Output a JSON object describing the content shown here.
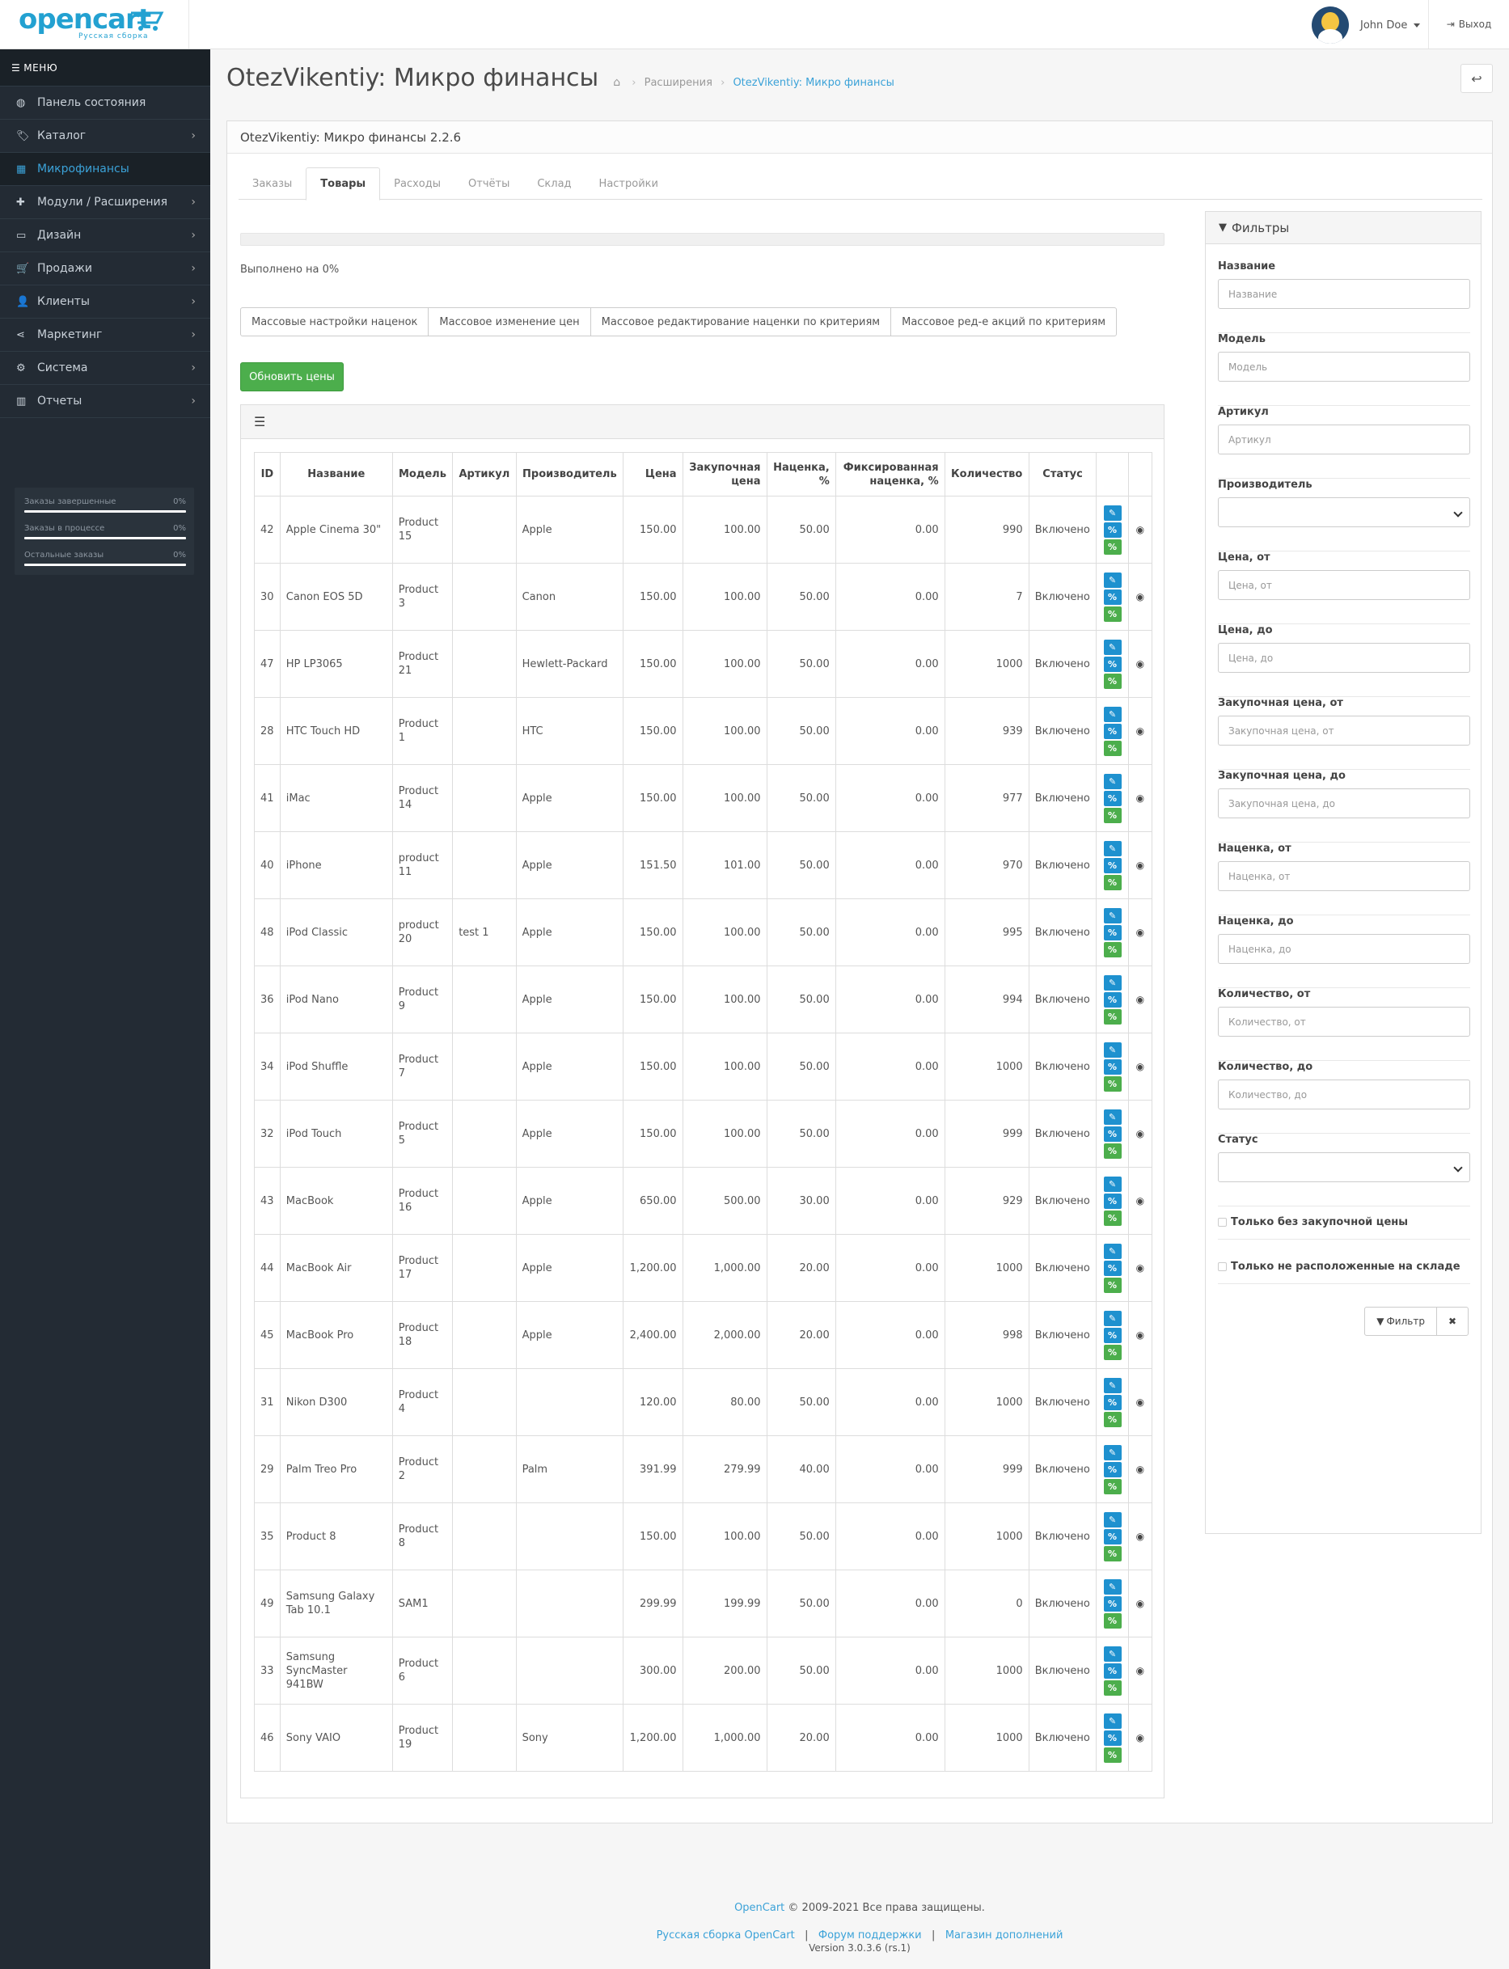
{
  "header": {
    "logo_word": "opencart",
    "logo_sub": "Русская сборка",
    "user_name": "John Doe",
    "logout": "Выход"
  },
  "sidebar": {
    "menu_label": "МЕНЮ",
    "items": [
      {
        "label": "Панель состояния",
        "icon": "dashboard-icon",
        "glyph": "◍",
        "arrow": false
      },
      {
        "label": "Каталог",
        "icon": "tags-icon",
        "glyph": "🏷",
        "arrow": true
      },
      {
        "label": "Микрофинансы",
        "icon": "table-icon",
        "glyph": "▦",
        "arrow": false,
        "active": true
      },
      {
        "label": "Модули / Расширения",
        "icon": "puzzle-icon",
        "glyph": "✚",
        "arrow": true
      },
      {
        "label": "Дизайн",
        "icon": "desktop-icon",
        "glyph": "▭",
        "arrow": true
      },
      {
        "label": "Продажи",
        "icon": "cart-icon",
        "glyph": "🛒",
        "arrow": true
      },
      {
        "label": "Клиенты",
        "icon": "user-icon",
        "glyph": "👤",
        "arrow": true
      },
      {
        "label": "Маркетинг",
        "icon": "share-icon",
        "glyph": "⋖",
        "arrow": true
      },
      {
        "label": "Система",
        "icon": "cog-icon",
        "glyph": "⚙",
        "arrow": true
      },
      {
        "label": "Отчеты",
        "icon": "bar-chart-icon",
        "glyph": "▥",
        "arrow": true
      }
    ],
    "stats": [
      {
        "label": "Заказы завершенные",
        "value": "0%",
        "progress": 0
      },
      {
        "label": "Заказы в процессе",
        "value": "0%",
        "progress": 0
      },
      {
        "label": "Остальные заказы",
        "value": "0%",
        "progress": 0
      }
    ]
  },
  "page": {
    "title": "OtezVikentiy: Микро финансы",
    "breadcrumb": [
      "Расширения",
      "OtezVikentiy: Микро финансы"
    ],
    "panel_title": "OtezVikentiy: Микро финансы 2.2.6",
    "tabs": [
      "Заказы",
      "Товары",
      "Расходы",
      "Отчёты",
      "Склад",
      "Настройки"
    ],
    "active_tab": "Товары",
    "progress_text": "Выполнено на 0%",
    "progress": 0,
    "mass_buttons": [
      "Массовые настройки наценок",
      "Массовое изменение цен",
      "Массовое редактирование наценки по критериям",
      "Массовое ред-е акций по критериям"
    ],
    "update_button": "Обновить цены"
  },
  "table": {
    "columns": [
      "ID",
      "Название",
      "Модель",
      "Артикул",
      "Производитель",
      "Цена",
      "Закупочная цена",
      "Наценка, %",
      "Фиксированная наценка, %",
      "Количество",
      "Статус"
    ],
    "rows": [
      {
        "id": "42",
        "name": "Apple Cinema 30\"",
        "model": "Product 15",
        "sku": "",
        "maker": "Apple",
        "price": "150.00",
        "cost": "100.00",
        "markup": "50.00",
        "fixed": "0.00",
        "qty": "990",
        "status": "Включено"
      },
      {
        "id": "30",
        "name": "Canon EOS 5D",
        "model": "Product 3",
        "sku": "",
        "maker": "Canon",
        "price": "150.00",
        "cost": "100.00",
        "markup": "50.00",
        "fixed": "0.00",
        "qty": "7",
        "status": "Включено"
      },
      {
        "id": "47",
        "name": "HP LP3065",
        "model": "Product 21",
        "sku": "",
        "maker": "Hewlett-Packard",
        "price": "150.00",
        "cost": "100.00",
        "markup": "50.00",
        "fixed": "0.00",
        "qty": "1000",
        "status": "Включено"
      },
      {
        "id": "28",
        "name": "HTC Touch HD",
        "model": "Product 1",
        "sku": "",
        "maker": "HTC",
        "price": "150.00",
        "cost": "100.00",
        "markup": "50.00",
        "fixed": "0.00",
        "qty": "939",
        "status": "Включено"
      },
      {
        "id": "41",
        "name": "iMac",
        "model": "Product 14",
        "sku": "",
        "maker": "Apple",
        "price": "150.00",
        "cost": "100.00",
        "markup": "50.00",
        "fixed": "0.00",
        "qty": "977",
        "status": "Включено"
      },
      {
        "id": "40",
        "name": "iPhone",
        "model": "product 11",
        "sku": "",
        "maker": "Apple",
        "price": "151.50",
        "cost": "101.00",
        "markup": "50.00",
        "fixed": "0.00",
        "qty": "970",
        "status": "Включено"
      },
      {
        "id": "48",
        "name": "iPod Classic",
        "model": "product 20",
        "sku": "test 1",
        "maker": "Apple",
        "price": "150.00",
        "cost": "100.00",
        "markup": "50.00",
        "fixed": "0.00",
        "qty": "995",
        "status": "Включено"
      },
      {
        "id": "36",
        "name": "iPod Nano",
        "model": "Product 9",
        "sku": "",
        "maker": "Apple",
        "price": "150.00",
        "cost": "100.00",
        "markup": "50.00",
        "fixed": "0.00",
        "qty": "994",
        "status": "Включено"
      },
      {
        "id": "34",
        "name": "iPod Shuffle",
        "model": "Product 7",
        "sku": "",
        "maker": "Apple",
        "price": "150.00",
        "cost": "100.00",
        "markup": "50.00",
        "fixed": "0.00",
        "qty": "1000",
        "status": "Включено"
      },
      {
        "id": "32",
        "name": "iPod Touch",
        "model": "Product 5",
        "sku": "",
        "maker": "Apple",
        "price": "150.00",
        "cost": "100.00",
        "markup": "50.00",
        "fixed": "0.00",
        "qty": "999",
        "status": "Включено"
      },
      {
        "id": "43",
        "name": "MacBook",
        "model": "Product 16",
        "sku": "",
        "maker": "Apple",
        "price": "650.00",
        "cost": "500.00",
        "markup": "30.00",
        "fixed": "0.00",
        "qty": "929",
        "status": "Включено"
      },
      {
        "id": "44",
        "name": "MacBook Air",
        "model": "Product 17",
        "sku": "",
        "maker": "Apple",
        "price": "1,200.00",
        "cost": "1,000.00",
        "markup": "20.00",
        "fixed": "0.00",
        "qty": "1000",
        "status": "Включено"
      },
      {
        "id": "45",
        "name": "MacBook Pro",
        "model": "Product 18",
        "sku": "",
        "maker": "Apple",
        "price": "2,400.00",
        "cost": "2,000.00",
        "markup": "20.00",
        "fixed": "0.00",
        "qty": "998",
        "status": "Включено"
      },
      {
        "id": "31",
        "name": "Nikon D300",
        "model": "Product 4",
        "sku": "",
        "maker": "",
        "price": "120.00",
        "cost": "80.00",
        "markup": "50.00",
        "fixed": "0.00",
        "qty": "1000",
        "status": "Включено"
      },
      {
        "id": "29",
        "name": "Palm Treo Pro",
        "model": "Product 2",
        "sku": "",
        "maker": "Palm",
        "price": "391.99",
        "cost": "279.99",
        "markup": "40.00",
        "fixed": "0.00",
        "qty": "999",
        "status": "Включено"
      },
      {
        "id": "35",
        "name": "Product 8",
        "model": "Product 8",
        "sku": "",
        "maker": "",
        "price": "150.00",
        "cost": "100.00",
        "markup": "50.00",
        "fixed": "0.00",
        "qty": "1000",
        "status": "Включено"
      },
      {
        "id": "49",
        "name": "Samsung Galaxy Tab 10.1",
        "model": "SAM1",
        "sku": "",
        "maker": "",
        "price": "299.99",
        "cost": "199.99",
        "markup": "50.00",
        "fixed": "0.00",
        "qty": "0",
        "status": "Включено"
      },
      {
        "id": "33",
        "name": "Samsung SyncMaster 941BW",
        "model": "Product 6",
        "sku": "",
        "maker": "",
        "price": "300.00",
        "cost": "200.00",
        "markup": "50.00",
        "fixed": "0.00",
        "qty": "1000",
        "status": "Включено"
      },
      {
        "id": "46",
        "name": "Sony VAIO",
        "model": "Product 19",
        "sku": "",
        "maker": "Sony",
        "price": "1,200.00",
        "cost": "1,000.00",
        "markup": "20.00",
        "fixed": "0.00",
        "qty": "1000",
        "status": "Включено"
      }
    ]
  },
  "filters": {
    "title": "Фильтры",
    "fields": [
      {
        "label": "Название",
        "placeholder": "Название",
        "type": "text"
      },
      {
        "label": "Модель",
        "placeholder": "Модель",
        "type": "text"
      },
      {
        "label": "Артикул",
        "placeholder": "Артикул",
        "type": "text"
      },
      {
        "label": "Производитель",
        "placeholder": "",
        "type": "select"
      },
      {
        "label": "Цена, от",
        "placeholder": "Цена, от",
        "type": "text"
      },
      {
        "label": "Цена, до",
        "placeholder": "Цена, до",
        "type": "text"
      },
      {
        "label": "Закупочная цена, от",
        "placeholder": "Закупочная цена, от",
        "type": "text"
      },
      {
        "label": "Закупочная цена, до",
        "placeholder": "Закупочная цена, до",
        "type": "text"
      },
      {
        "label": "Наценка, от",
        "placeholder": "Наценка, от",
        "type": "text"
      },
      {
        "label": "Наценка, до",
        "placeholder": "Наценка, до",
        "type": "text"
      },
      {
        "label": "Количество, от",
        "placeholder": "Количество, от",
        "type": "text"
      },
      {
        "label": "Количество, до",
        "placeholder": "Количество, до",
        "type": "text"
      },
      {
        "label": "Статус",
        "placeholder": "",
        "type": "select"
      }
    ],
    "checkboxes": [
      "Только без закупочной цены",
      "Только не расположенные на складе"
    ],
    "filter_button": "Фильтр",
    "clear_button": "✖"
  },
  "footer": {
    "brand": "OpenCart",
    "copyright": "© 2009-2021 Все права защищены.",
    "links": [
      "Русская сборка OpenCart",
      "Форум поддержки",
      "Магазин дополнений"
    ],
    "version": "Version 3.0.3.6 (rs.1)"
  },
  "colors": {
    "accent": "#3ba2d8",
    "sidebar_bg": "#232b34",
    "success": "#4cae4c",
    "primary": "#1e91cf"
  }
}
